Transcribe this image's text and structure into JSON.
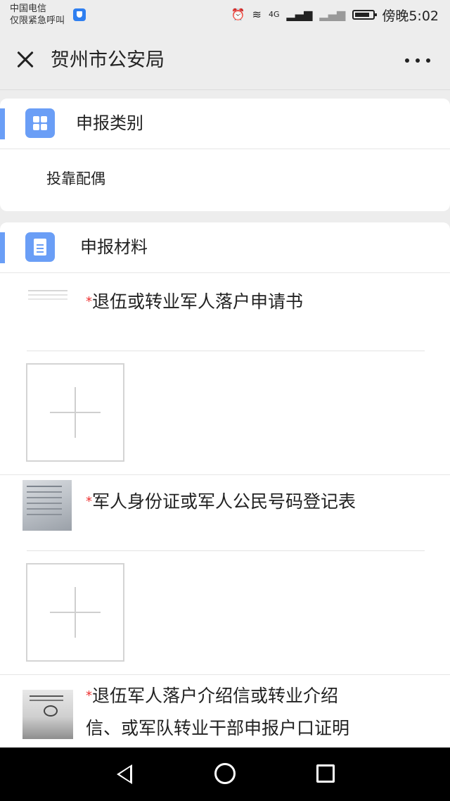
{
  "status_bar": {
    "carrier_line1": "中国电信",
    "carrier_line2": "仅限紧急呼叫",
    "network_label": "4G",
    "time": "傍晚5:02"
  },
  "title_bar": {
    "title": "贺州市公安局"
  },
  "category_section": {
    "title": "申报类别",
    "value": "投靠配偶"
  },
  "materials_section": {
    "title": "申报材料",
    "required_mark": "*",
    "items": [
      {
        "label": "退伍或转业军人落户申请书"
      },
      {
        "label": "军人身份证或军人公民号码登记表"
      },
      {
        "label_line1": "退伍军人落户介绍信或转业介绍",
        "label_line2": "信、或军队转业干部申报户口证明"
      }
    ]
  },
  "colors": {
    "accent": "#6a9ef6",
    "required": "#e33333",
    "background": "#ededed"
  }
}
